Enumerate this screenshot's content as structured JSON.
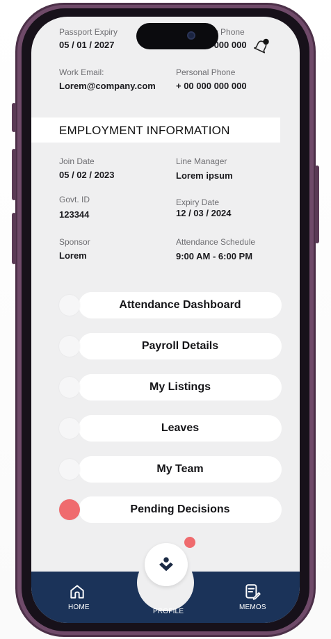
{
  "profile": {
    "passport_expiry_label": "Passport Expiry",
    "passport_expiry_value": "05 / 01 / 2027",
    "emergency_phone_label": "Emergency Phone",
    "emergency_phone_value": "+ 00 000 000 000",
    "work_email_label": "Work Email:",
    "work_email_value": "Lorem@company.com",
    "personal_phone_label": "Personal Phone",
    "personal_phone_value": "+ 00 000 000 000"
  },
  "employment": {
    "section_title": "EMPLOYMENT INFORMATION",
    "join_date_label": "Join Date",
    "join_date_value": "05 / 02 / 2023",
    "line_manager_label": "Line Manager",
    "line_manager_value": "Lorem ipsum",
    "govt_id_label": "Govt. ID",
    "govt_id_value": "123344",
    "expiry_date_label": "Expiry Date",
    "expiry_date_value": "12 / 03 / 2024",
    "sponsor_label": "Sponsor",
    "sponsor_value": "Lorem",
    "attendance_schedule_label": "Attendance Schedule",
    "attendance_schedule_value": "9:00 AM - 6:00 PM"
  },
  "menu": {
    "items": [
      {
        "label": "Attendance Dashboard"
      },
      {
        "label": "Payroll Details"
      },
      {
        "label": "My Listings"
      },
      {
        "label": "Leaves"
      },
      {
        "label": "My Team"
      },
      {
        "label": "Pending Decisions"
      }
    ]
  },
  "nav": {
    "home_label": "HOME",
    "profile_label": "PROFILE",
    "memos_label": "MEMOS"
  },
  "icons": {
    "bell": "bell-icon",
    "home": "home-icon",
    "profile": "profile-icon",
    "memos": "memo-icon"
  },
  "colors": {
    "nav_background": "#1b3359",
    "alert": "#ef6b6e",
    "frame": "#6f4a69",
    "screen_background": "#efeff0"
  }
}
